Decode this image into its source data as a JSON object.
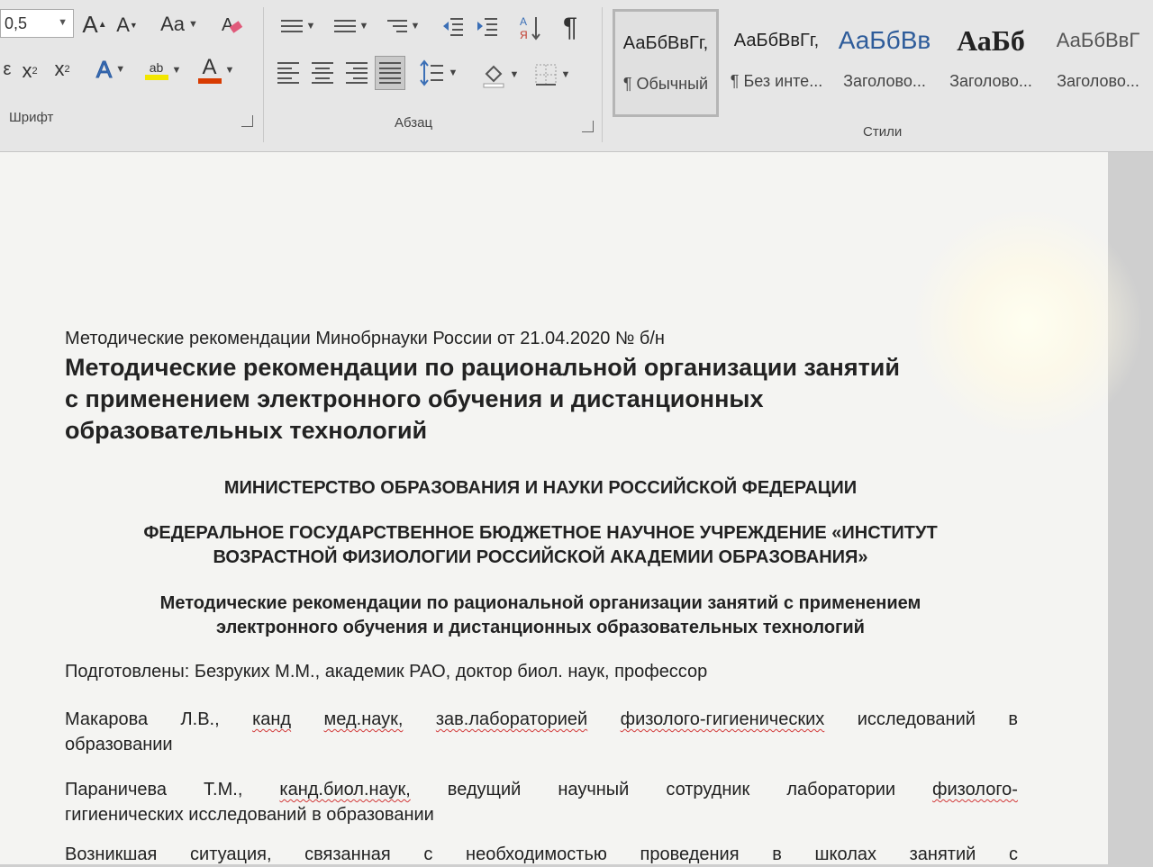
{
  "ribbon": {
    "font_size_value": "0,5",
    "font_group_label": "Шрифт",
    "paragraph_group_label": "Абзац",
    "styles_group_label": "Стили",
    "case_button_label": "Aa",
    "highlight_label": "ab",
    "styles": [
      {
        "sample": "АаБбВвГг,",
        "name": "¶ Обычный"
      },
      {
        "sample": "АаБбВвГг,",
        "name": "¶ Без инте..."
      },
      {
        "sample": "АаБбВв",
        "name": "Заголово..."
      },
      {
        "sample": "АаБб",
        "name": "Заголово..."
      },
      {
        "sample": "АаБбВвГ",
        "name": "Заголово..."
      }
    ],
    "colors": {
      "highlight": "#f2e600",
      "font_color": "#d83b01",
      "accent": "#3b6fb6"
    }
  },
  "document": {
    "subtitle": "Методические рекомендации Минобрнауки России от 21.04.2020 № б/н",
    "title_lines": [
      "Методические рекомендации по рациональной организации занятий",
      "с применением электронного обучения и дистанционных",
      "образовательных технологий"
    ],
    "ministry": "МИНИСТЕРСТВО ОБРАЗОВАНИЯ И НАУКИ РОССИЙСКОЙ ФЕДЕРАЦИИ",
    "institute_lines": [
      "ФЕДЕРАЛЬНОЕ ГОСУДАРСТВЕННОЕ БЮДЖЕТНОЕ НАУЧНОЕ УЧРЕЖДЕНИЕ «ИНСТИТУТ",
      "ВОЗРАСТНОЙ ФИЗИОЛОГИИ РОССИЙСКОЙ АКАДЕМИИ ОБРАЗОВАНИЯ»"
    ],
    "heading2_lines": [
      "Методические рекомендации по рациональной организации занятий с применением",
      "электронного обучения и дистанционных образовательных технологий"
    ],
    "prepared": "Подготовлены: Безруких М.М., академик РАО, доктор биол. наук, профессор",
    "makarova": {
      "words": [
        "Макарова",
        "Л.В.,",
        "канд",
        "мед.наук,",
        "зав.лабораторией",
        "физолого-гигиенических",
        "исследований",
        "в"
      ],
      "rest": "образовании"
    },
    "paranicheva": {
      "words": [
        "Параничева",
        "Т.М.,",
        "канд.биол.наук,",
        "ведущий",
        "научный",
        "сотрудник",
        "лаборатории",
        "физолого-"
      ],
      "rest": "гигиенических исследований в образовании"
    },
    "last_line_words": [
      "Возникшая",
      "ситуация,",
      "связанная",
      "с",
      "необходимостью",
      "проведения",
      "в",
      "школах",
      "занятий",
      "с"
    ]
  }
}
